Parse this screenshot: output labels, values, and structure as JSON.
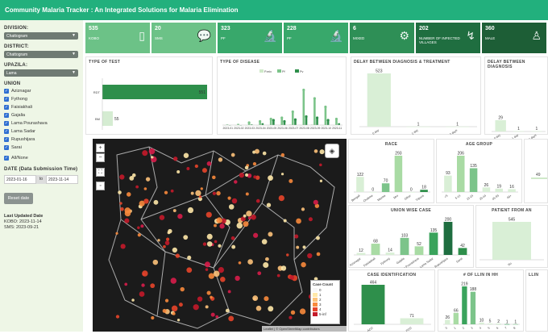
{
  "header": {
    "title": "Community Malaria Tracker : An Integrated Solutions for Malaria Elimination"
  },
  "sidebar": {
    "division_label": "DIVISION:",
    "division_value": "Chattogram",
    "district_label": "DISTRICT:",
    "district_value": "Chattogram",
    "upazila_label": "UPAZILA:",
    "upazila_value": "Lama",
    "union_label": "UNION",
    "unions": [
      "Aziznagar",
      "Fythong",
      "Faisiakhali",
      "Gajalia",
      "Lama Pourashava",
      "Lama Sadar",
      "Rupushijara",
      "Sarai"
    ],
    "all_none": "All/None",
    "date_label": "DATE (Data Submission Time)",
    "date_from": "2023-01-16",
    "date_to_sep": "to",
    "date_to": "2023-11-14",
    "reset_label": "Reset date",
    "last_updated_label": "Last Updated Date",
    "kobo": "KOBO: 2023-11-14",
    "sms": "SMS: 2023-09-21"
  },
  "kpis": [
    {
      "value": "535",
      "name": "KOBO",
      "color": "#6cc287",
      "icon": "phone-icon"
    },
    {
      "value": "20",
      "name": "SMS",
      "color": "#6cc287",
      "icon": "chat-icon"
    },
    {
      "value": "323",
      "name": "PF",
      "color": "#38a86b",
      "icon": "microscope-icon"
    },
    {
      "value": "228",
      "name": "PF",
      "color": "#38a86b",
      "icon": "microscope-icon"
    },
    {
      "value": "6",
      "name": "MIXED",
      "color": "#2e8f56",
      "icon": "gears-icon"
    },
    {
      "value": "202",
      "name": "NUMBER OF INFECTED VILLAGES",
      "color": "#1f6e40",
      "icon": "route-icon"
    },
    {
      "value": "360",
      "name": "MALE",
      "color": "#1d5e36",
      "icon": "person-icon"
    }
  ],
  "panels": {
    "type_of_test": "TYPE OF TEST",
    "type_of_disease": "TYPE OF DISEASE",
    "delay_treatment": "DELAY BETWEEN DIAGNOSIS & TREATMENT",
    "delay_diagnosis": "DELAY BETWEEN DIAGNOSIS",
    "race": "RACE",
    "age_group": "AGE GROUP",
    "union_wise": "UNION WISE CASE",
    "patient_from": "PATIENT FROM AN",
    "case_identification": "CASE IDENTIFICATION",
    "llin": "# OF LLIN IN HH",
    "llin2": "LLIN"
  },
  "map": {
    "zoom_in": "+",
    "zoom_out": "−",
    "legend_title": "Case Count",
    "legend_items": [
      "0",
      "1",
      "2",
      "3",
      "4",
      "5-inf"
    ],
    "attribution": "Leaflet | © OpenStreetMap contributors"
  },
  "chart_data": [
    {
      "type": "bar",
      "title": "TYPE OF TEST",
      "categories": [
        "RDT",
        "BM"
      ],
      "values": [
        551,
        55
      ],
      "orientation": "horizontal"
    },
    {
      "type": "bar",
      "title": "TYPE OF DISEASE",
      "legend": [
        "P.mix",
        "Pf",
        "Pv"
      ],
      "x": [
        "2023-01",
        "2023-02",
        "2023-03",
        "2023-04",
        "2023-05",
        "2023-06",
        "2023-07",
        "2023-08",
        "2023-09",
        "2023-10",
        "2023-11"
      ]
    },
    {
      "type": "bar",
      "title": "DELAY BETWEEN DIAGNOSIS & TREATMENT",
      "categories": [
        "0 day",
        "1 day",
        "> 7 days"
      ],
      "values": [
        523,
        1,
        1
      ]
    },
    {
      "type": "bar",
      "title": "DELAY BETWEEN DIAGNOSIS",
      "categories": [
        "0 day",
        "1 day",
        "2 days"
      ],
      "values": [
        29,
        1,
        1
      ]
    },
    {
      "type": "bar",
      "title": "RACE",
      "categories": [
        "Bengali",
        "Chakma",
        "Marma",
        "Mro",
        "Other",
        "Tripura"
      ],
      "values": [
        122,
        0,
        70,
        293,
        0,
        18
      ]
    },
    {
      "type": "bar",
      "title": "AGE GROUP",
      "categories": [
        "<5",
        "5-14",
        "15-24",
        "25-44",
        "45-59",
        "60+"
      ],
      "values": [
        93,
        206,
        135,
        26,
        19,
        16
      ]
    },
    {
      "type": "bar",
      "title": "UNION WISE CASE",
      "categories": [
        "Aziznagar",
        "Faisiakhali",
        "Fythong",
        "Gajalia",
        "Lama Pourashava",
        "Lama Sadar",
        "Rupushijara",
        "Sarai"
      ],
      "values": [
        12,
        68,
        14,
        103,
        52,
        135,
        200,
        42
      ]
    },
    {
      "type": "bar",
      "title": "PATIENT FROM AN",
      "categories": [
        "No"
      ],
      "values": [
        545
      ]
    },
    {
      "type": "bar",
      "title": "CASE IDENTIFICATION",
      "categories": [
        "ACD",
        "PCD"
      ],
      "values": [
        464,
        71
      ]
    },
    {
      "type": "bar",
      "title": "# OF LLIN IN HH",
      "categories": [
        "0",
        "1",
        "2",
        "3",
        "4",
        "5",
        "6",
        "7",
        "8"
      ],
      "values": [
        26,
        66,
        219,
        188,
        10,
        5,
        2,
        1,
        1
      ]
    }
  ]
}
